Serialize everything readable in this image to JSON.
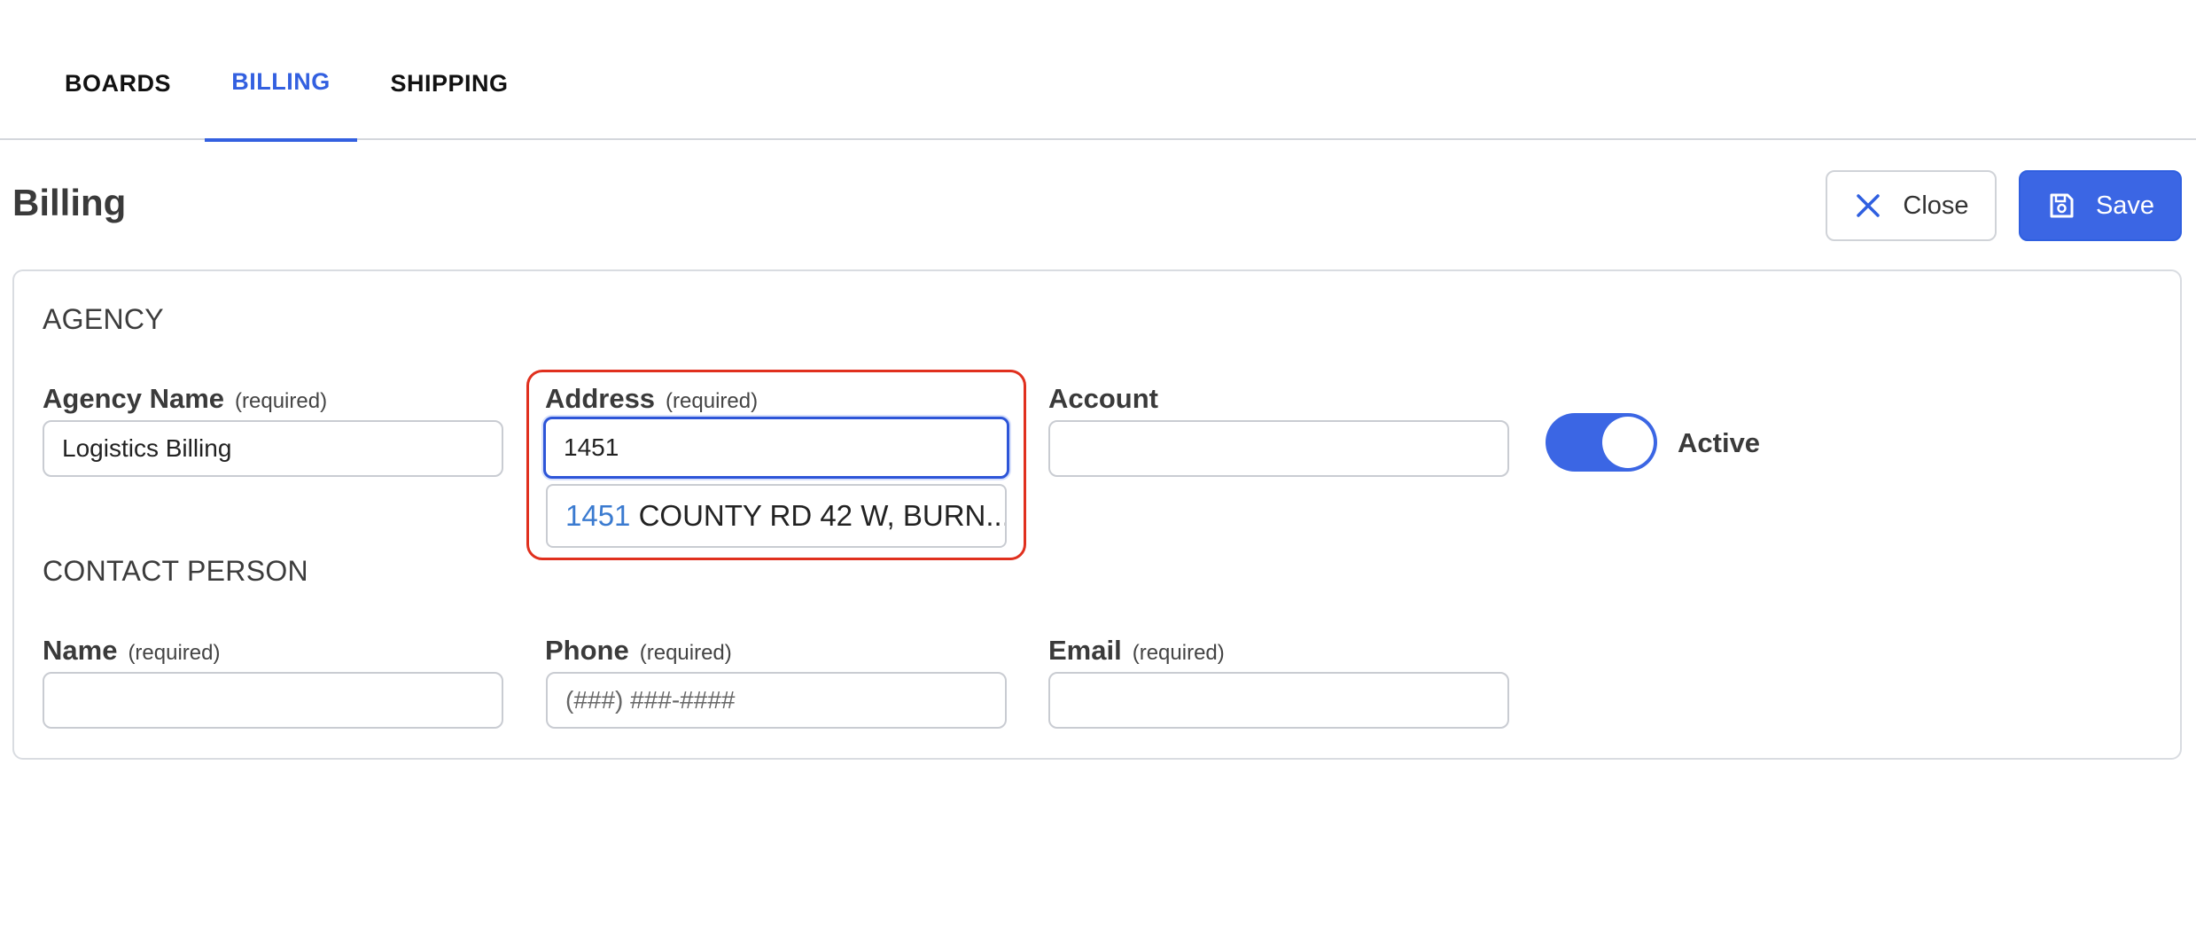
{
  "tabs": [
    {
      "label": "BOARDS",
      "active": false
    },
    {
      "label": "BILLING",
      "active": true
    },
    {
      "label": "SHIPPING",
      "active": false
    }
  ],
  "header": {
    "title": "Billing",
    "close_label": "Close",
    "save_label": "Save"
  },
  "agency": {
    "section_title": "AGENCY",
    "agency_name": {
      "label": "Agency Name",
      "required": "(required)",
      "value": "Logistics Billing"
    },
    "address": {
      "label": "Address",
      "required": "(required)",
      "value": "1451"
    },
    "address_suggestion": {
      "match": "1451",
      "rest": " COUNTY RD 42 W, BURN..."
    },
    "account": {
      "label": "Account",
      "value": ""
    },
    "active": {
      "label": "Active",
      "on": true
    }
  },
  "contact": {
    "section_title": "CONTACT PERSON",
    "name": {
      "label": "Name",
      "required": "(required)",
      "value": ""
    },
    "phone": {
      "label": "Phone",
      "required": "(required)",
      "placeholder": "(###) ###-####"
    },
    "email": {
      "label": "Email",
      "required": "(required)",
      "value": ""
    }
  },
  "colors": {
    "accent": "#3b66e4",
    "highlight": "#e0301e",
    "suggestion_match": "#3b7bd0"
  }
}
